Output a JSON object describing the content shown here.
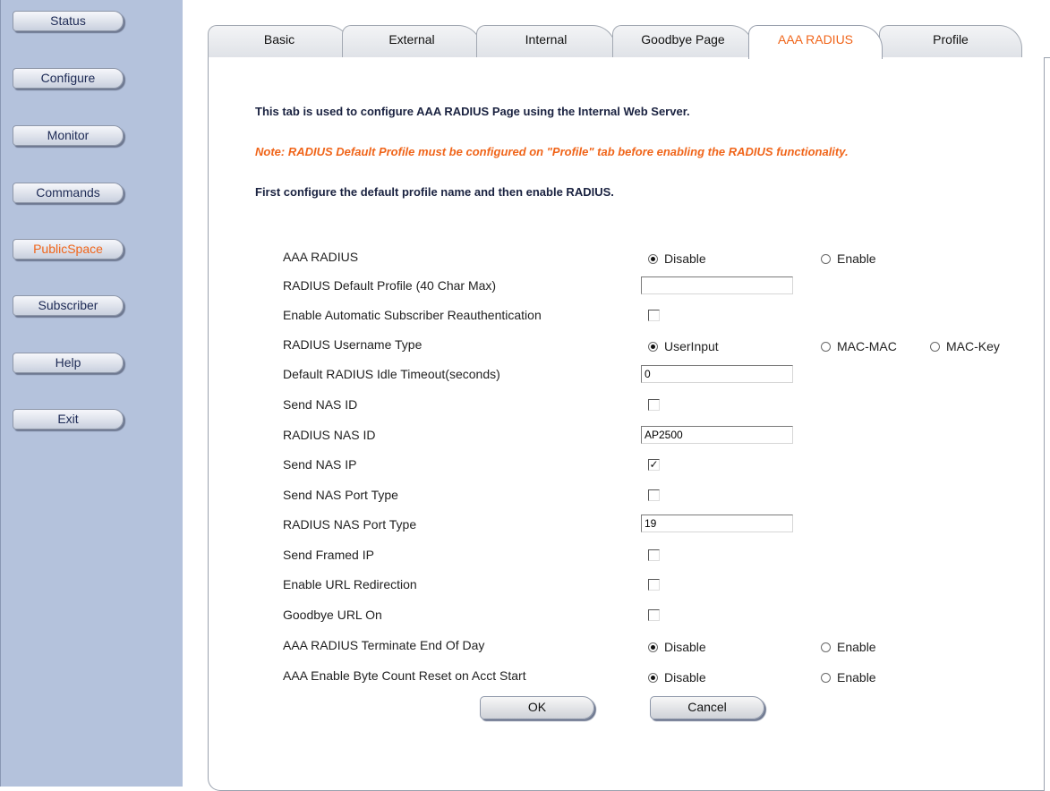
{
  "nav": {
    "items": [
      {
        "label": "Status"
      },
      {
        "label": "Configure"
      },
      {
        "label": "Monitor"
      },
      {
        "label": "Commands"
      },
      {
        "label": "PublicSpace"
      },
      {
        "label": "Subscriber"
      },
      {
        "label": "Help"
      },
      {
        "label": "Exit"
      }
    ],
    "active": "PublicSpace"
  },
  "tabs": [
    {
      "label": "Basic"
    },
    {
      "label": "External"
    },
    {
      "label": "Internal"
    },
    {
      "label": "Goodbye Page"
    },
    {
      "label": "AAA RADIUS"
    },
    {
      "label": "Profile"
    }
  ],
  "active_tab": "AAA RADIUS",
  "messages": {
    "intro": "This tab is used to configure AAA RADIUS Page using the Internal Web Server.",
    "note": "Note: RADIUS Default Profile must be configured on \"Profile\" tab before enabling the RADIUS functionality.",
    "first": "First configure the default profile name and then enable RADIUS."
  },
  "form": {
    "aaa_radius": {
      "label": "AAA RADIUS",
      "options": [
        "Disable",
        "Enable"
      ],
      "selected": "Disable"
    },
    "default_profile": {
      "label": "RADIUS Default Profile (40 Char Max)",
      "value": ""
    },
    "auto_reauth": {
      "label": "Enable Automatic Subscriber Reauthentication",
      "checked": false
    },
    "username_type": {
      "label": "RADIUS Username Type",
      "options": [
        "UserInput",
        "MAC-MAC",
        "MAC-Key"
      ],
      "selected": "UserInput"
    },
    "idle_timeout": {
      "label": "Default RADIUS Idle Timeout(seconds)",
      "value": "0"
    },
    "send_nas_id": {
      "label": "Send NAS ID",
      "checked": false
    },
    "nas_id": {
      "label": "RADIUS NAS ID",
      "value": "AP2500"
    },
    "send_nas_ip": {
      "label": "Send NAS IP",
      "checked": true
    },
    "send_nas_port_type": {
      "label": "Send NAS Port Type",
      "checked": false
    },
    "nas_port_type": {
      "label": "RADIUS NAS Port Type",
      "value": "19"
    },
    "send_framed_ip": {
      "label": "Send Framed IP",
      "checked": false
    },
    "url_redirect": {
      "label": "Enable URL Redirection",
      "checked": false
    },
    "goodbye_url": {
      "label": "Goodbye URL On",
      "checked": false
    },
    "terminate_eod": {
      "label": "AAA RADIUS Terminate End Of Day",
      "options": [
        "Disable",
        "Enable"
      ],
      "selected": "Disable"
    },
    "byte_reset": {
      "label": "AAA Enable Byte Count Reset on Acct Start",
      "options": [
        "Disable",
        "Enable"
      ],
      "selected": "Disable"
    }
  },
  "buttons": {
    "ok": "OK",
    "cancel": "Cancel"
  },
  "colors": {
    "sidebar": "#b4c2dc",
    "accent": "#f0651a",
    "heading": "#1a2240"
  }
}
